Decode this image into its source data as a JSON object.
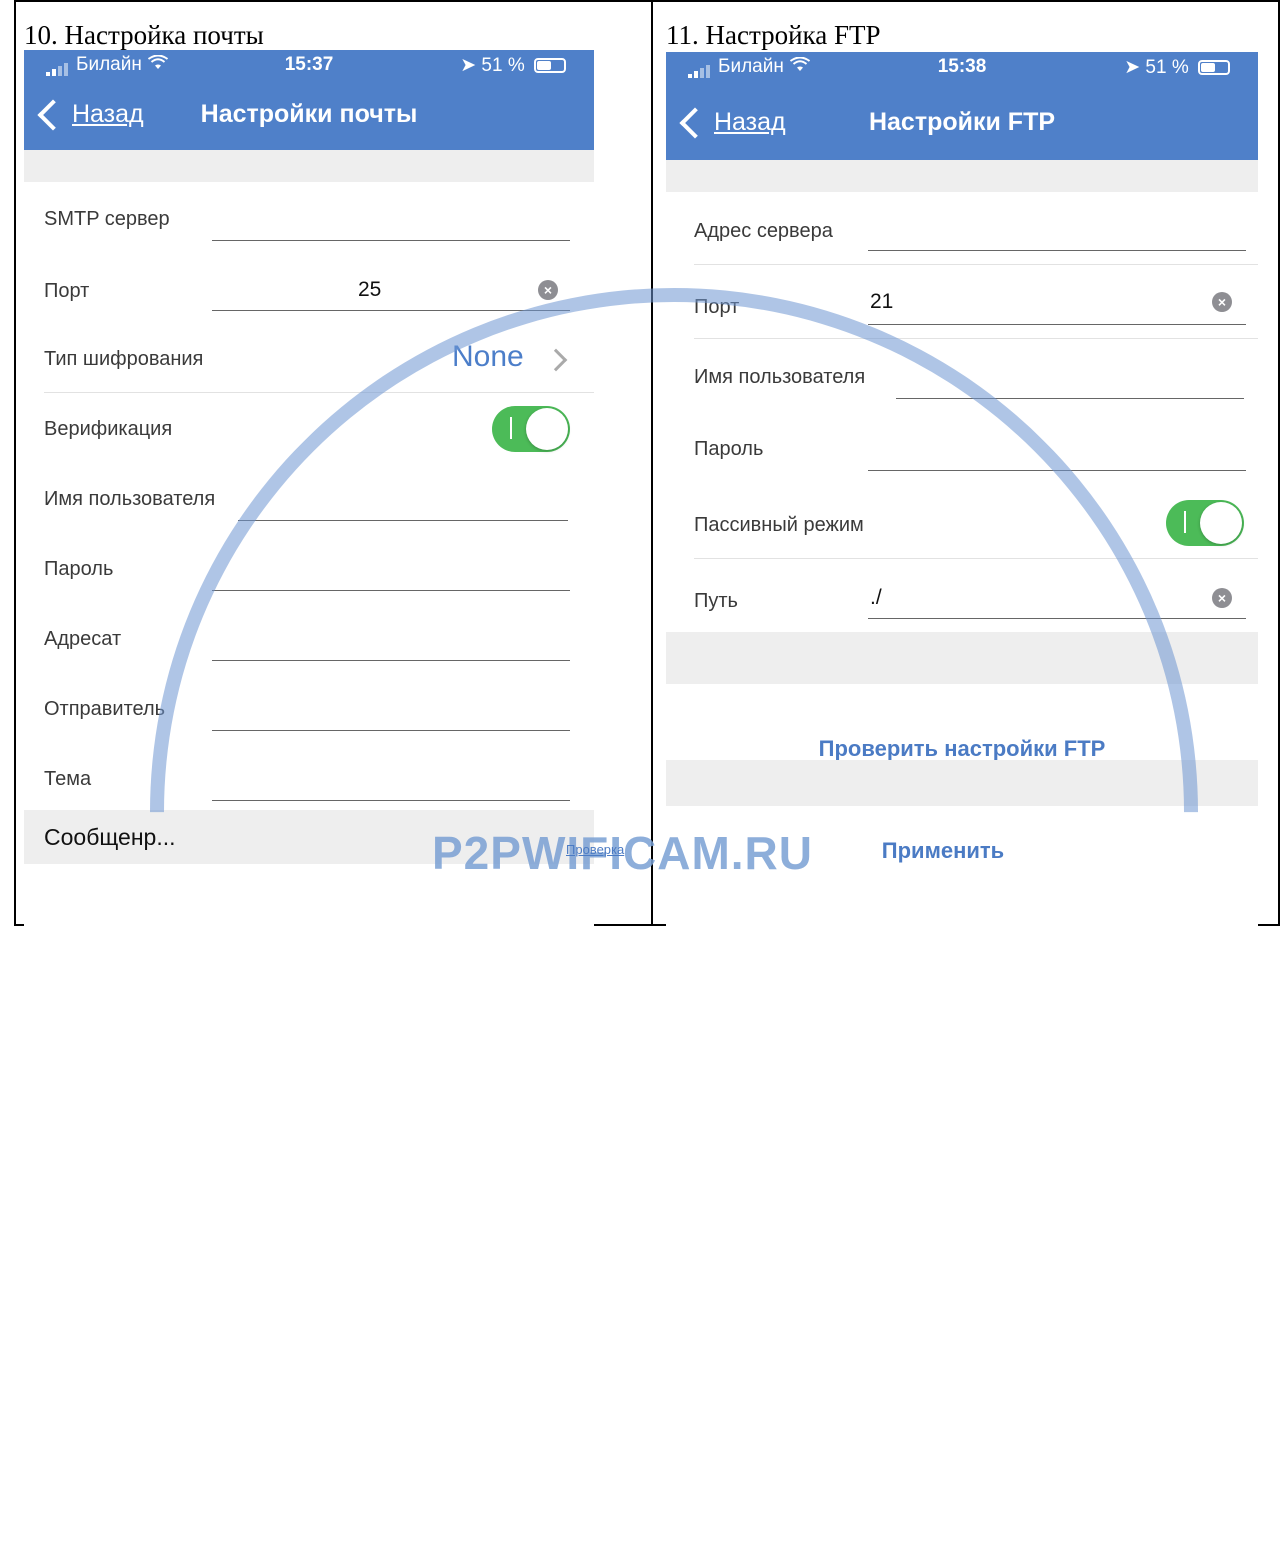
{
  "left": {
    "caption": "10. Настройка почты",
    "status": {
      "carrier": "Билайн",
      "time": "15:37",
      "battery": "51 %"
    },
    "nav": {
      "back_label": "Назад",
      "title": "Настройки почты"
    },
    "fields": {
      "smtp": {
        "label": "SMTP сервер",
        "value": ""
      },
      "port": {
        "label": "Порт",
        "value": "25"
      },
      "encryption": {
        "label": "Тип шифрования",
        "value": "None"
      },
      "verification": {
        "label": "Верификация",
        "enabled": true
      },
      "username": {
        "label": "Имя пользователя",
        "value": ""
      },
      "password": {
        "label": "Пароль",
        "value": ""
      },
      "recipient": {
        "label": "Адресат",
        "value": ""
      },
      "sender": {
        "label": "Отправитель",
        "value": ""
      },
      "subject": {
        "label": "Тема",
        "value": ""
      }
    },
    "footer": {
      "message_label": "Сообщенр...",
      "check_link": "Проверка"
    }
  },
  "right": {
    "caption": "11. Настройка FTP",
    "status": {
      "carrier": "Билайн",
      "time": "15:38",
      "battery": "51 %"
    },
    "nav": {
      "back_label": "Назад",
      "title": "Настройки FTP"
    },
    "fields": {
      "server": {
        "label": "Адрес сервера",
        "value": ""
      },
      "port": {
        "label": "Порт",
        "value": "21"
      },
      "username": {
        "label": "Имя пользователя",
        "value": ""
      },
      "password": {
        "label": "Пароль",
        "value": ""
      },
      "passive": {
        "label": "Пассивный режим",
        "enabled": true
      },
      "path": {
        "label": "Путь",
        "value": "./"
      }
    },
    "check_button": "Проверить настройки FTP",
    "apply_button": "Применить"
  },
  "watermark": "P2PWIFICAM.RU",
  "colors": {
    "accent": "#4f80c9",
    "toggle_on": "#4cbb58",
    "link": "#4b7bc4"
  }
}
